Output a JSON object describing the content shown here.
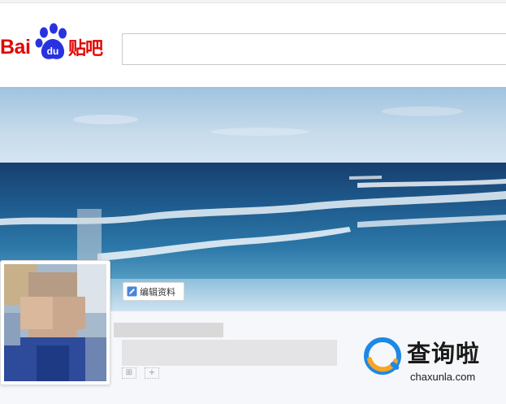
{
  "header": {
    "logo_bai": "Bai",
    "logo_du": "du",
    "logo_tieba": "贴吧",
    "search": {
      "value": "",
      "placeholder": ""
    }
  },
  "banner": {
    "edit_profile_label": "编辑资料"
  },
  "watermark": {
    "title": "查询啦",
    "domain": "chaxunla.com"
  },
  "colors": {
    "brand_red": "#e10602",
    "brand_blue": "#2932e1",
    "sea_dark": "#1f5b8e",
    "sky": "#c9dcec",
    "watermark_blue": "#1e88e5",
    "watermark_orange": "#f5a623"
  },
  "icons": {
    "logo": "baidu-paw-icon",
    "edit": "edit-pencil-icon",
    "watermark": "chaxunla-logo-icon"
  }
}
